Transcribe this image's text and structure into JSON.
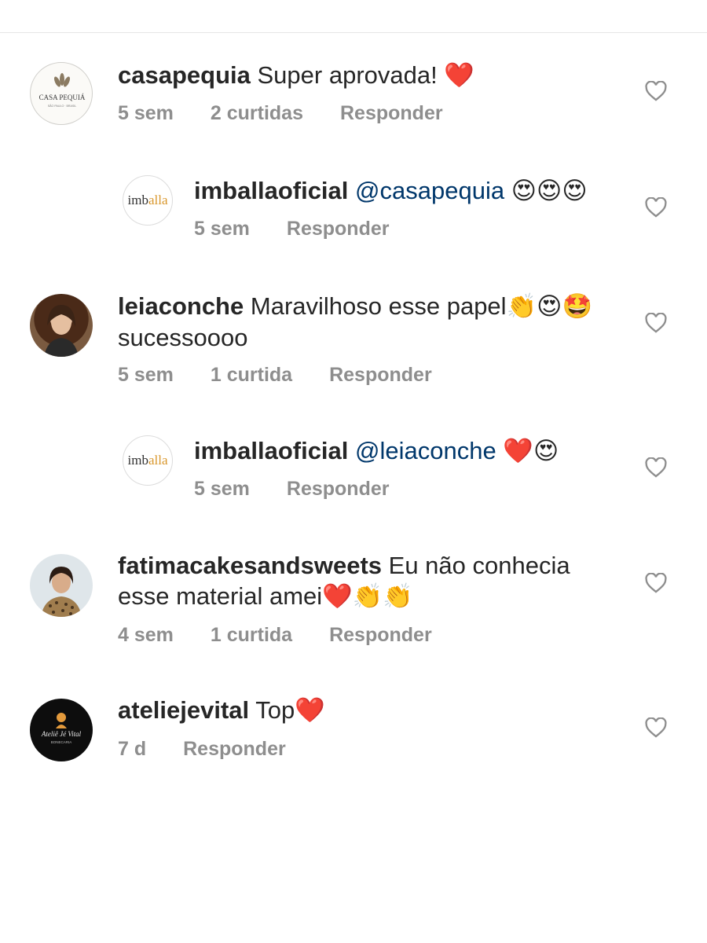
{
  "colors": {
    "meta": "#8e8e8e",
    "mention": "#00376b",
    "heart": "#ed2f44"
  },
  "comments": [
    {
      "username": "casapequia",
      "text": "Super aprovada! ",
      "emojis": "❤️",
      "time": "5 sem",
      "likes": "2 curtidas",
      "reply_label": "Responder",
      "avatar_text": "CASA PEQUIÁ",
      "avatar_sub": "SÃO PAULO · BRASIL"
    },
    {
      "username": "imballaoficial",
      "mention": "@casapequia",
      "text": " ",
      "emojis": "😍😍😍",
      "time": "5 sem",
      "reply_label": "Responder",
      "avatar_text": "imballa"
    },
    {
      "username": "leiaconche",
      "text": "Maravilhoso esse papel",
      "emojis": "👏😍🤩",
      "text2": "sucessoooo",
      "time": "5 sem",
      "likes": "1 curtida",
      "reply_label": "Responder"
    },
    {
      "username": "imballaoficial",
      "mention": "@leiaconche",
      "text": " ",
      "emojis": "❤️😍",
      "time": "5 sem",
      "reply_label": "Responder",
      "avatar_text": "imballa"
    },
    {
      "username": "fatimacakesandsweets",
      "text": "Eu não conhecia",
      "text2": "esse material amei",
      "emojis": "❤️👏👏",
      "time": "4 sem",
      "likes": "1 curtida",
      "reply_label": "Responder"
    },
    {
      "username": "ateliejevital",
      "text": "Top",
      "emojis": "❤️",
      "time": "7 d",
      "reply_label": "Responder",
      "avatar_text": "Ateliê Jé Vital",
      "avatar_sub": "BONECARIA"
    }
  ]
}
